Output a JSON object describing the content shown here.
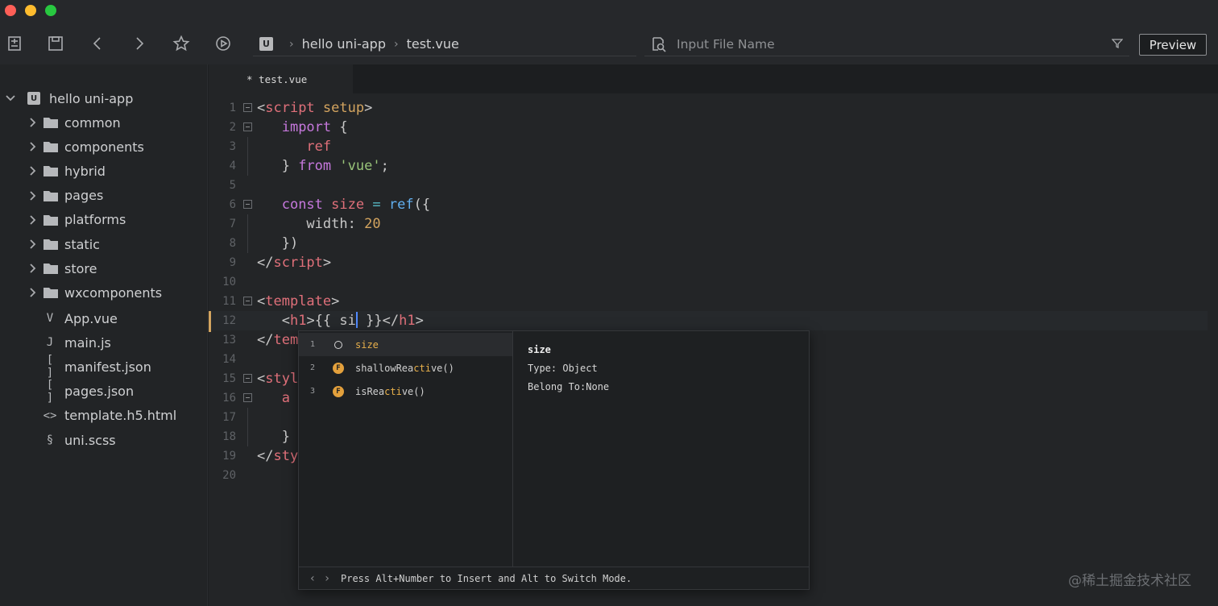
{
  "toolbar": {
    "breadcrumb": {
      "logo": "U",
      "project": "hello uni-app",
      "file": "test.vue"
    },
    "search_placeholder": "Input File Name",
    "preview_label": "Preview"
  },
  "sidebar": {
    "root": "hello uni-app",
    "root_logo": "U",
    "folders": [
      "common",
      "components",
      "hybrid",
      "pages",
      "platforms",
      "static",
      "store",
      "wxcomponents"
    ],
    "files": [
      {
        "name": "App.vue",
        "icon": "vue-file-icon",
        "glyph": "V"
      },
      {
        "name": "main.js",
        "icon": "js-file-icon",
        "glyph": "J"
      },
      {
        "name": "manifest.json",
        "icon": "json-file-icon",
        "glyph": "[ ]"
      },
      {
        "name": "pages.json",
        "icon": "json-file-icon",
        "glyph": "[ ]"
      },
      {
        "name": "template.h5.html",
        "icon": "html-file-icon",
        "glyph": "<>"
      },
      {
        "name": "uni.scss",
        "icon": "scss-file-icon",
        "glyph": "§"
      }
    ]
  },
  "editor": {
    "tab_label": "* test.vue",
    "line_numbers": [
      "1",
      "2",
      "3",
      "4",
      "5",
      "6",
      "7",
      "8",
      "9",
      "10",
      "11",
      "12",
      "13",
      "14",
      "15",
      "16",
      "17",
      "18",
      "19",
      "20"
    ],
    "lines": {
      "l1": {
        "tag_open": "<",
        "tag": "script",
        "attr": "setup",
        "tag_close": ">"
      },
      "l2": {
        "kw": "import",
        "rest": " {"
      },
      "l3": {
        "var": "ref"
      },
      "l4": {
        "open": "} ",
        "kw": "from",
        "str": "'vue'",
        "end": ";"
      },
      "l6": {
        "kw": "const",
        "var": "size",
        "op": "=",
        "fn": "ref",
        "rest": "({"
      },
      "l7": {
        "prop": "width",
        "colon": ": ",
        "num": "20"
      },
      "l8": {
        "text": "})"
      },
      "l9": {
        "text": "</",
        "tag": "script",
        "close": ">"
      },
      "l11": {
        "open": "<",
        "tag": "template",
        "close": ">"
      },
      "l12": {
        "open": "<",
        "tag": "h1",
        "mid": ">{{ si",
        "after": " }}",
        "close_open": "</",
        "close_tag": "h1",
        "close": ">"
      },
      "l13": {
        "open": "</",
        "tag": "tem"
      },
      "l15": {
        "open": "<",
        "tag": "styl"
      },
      "l16": {
        "tag": "a"
      },
      "l18": {
        "text": "}"
      },
      "l19": {
        "open": "</",
        "tag": "sty"
      }
    }
  },
  "autocomplete": {
    "items": [
      {
        "num": "1",
        "kind": "O",
        "label": "size",
        "match": ""
      },
      {
        "num": "2",
        "kind": "F",
        "pre": "shallowRea",
        "match": "cti",
        "post": "ve()"
      },
      {
        "num": "3",
        "kind": "F",
        "pre": "isRea",
        "match": "cti",
        "post": "ve()"
      }
    ],
    "detail": {
      "title": "size",
      "type": "Type: Object",
      "belong": "Belong To:None"
    },
    "footer_hint": "Press Alt+Number to Insert and Alt to Switch Mode."
  },
  "watermark": "@稀土掘金技术社区"
}
